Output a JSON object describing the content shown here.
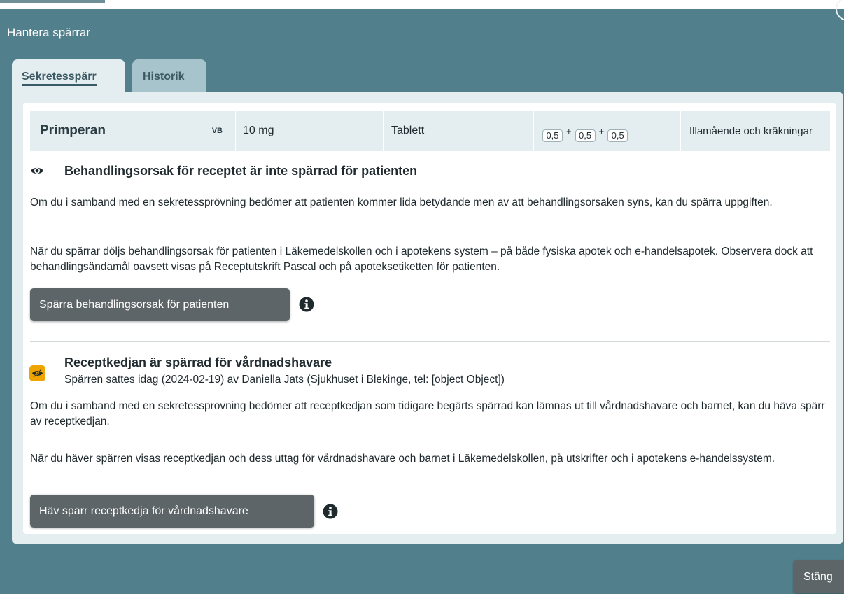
{
  "dialog": {
    "title": "Hantera spärrar"
  },
  "tabs": [
    {
      "label": "Sekretesspärr",
      "active": true
    },
    {
      "label": "Historik",
      "active": false
    }
  ],
  "drug": {
    "name": "Primperan",
    "badge": "VB",
    "strength": "10 mg",
    "form": "Tablett",
    "dosage": [
      "0,5",
      "0,5",
      "0,5"
    ],
    "dosage_separator": "+",
    "indication": "Illamående och kräkningar"
  },
  "treatment_reason": {
    "icon": "eye-icon",
    "heading": "Behandlingsorsak för receptet är inte spärrad för patienten",
    "paragraph1": "Om du i samband med en sekretessprövning bedömer att patienten kommer lida betydande men av att behandlingsorsaken syns, kan du spärra uppgiften.",
    "paragraph2": "När du spärrar döljs behandlingsorsak för patienten i Läkemedelskollen och i apotekens system – på både fysiska apotek och e-handelsapotek. Observera dock att behandlingsändamål oavsett visas på Receptutskrift Pascal och på apoteksetiketten för patienten.",
    "button": "Spärra behandlingsorsak för patienten"
  },
  "prescription_chain": {
    "icon": "eye-slash-icon",
    "badge_color": "#f0a400",
    "heading": "Receptkedjan är spärrad för vårdnadshavare",
    "subline": "Spärren sattes idag (2024-02-19) av Daniella Jats (Sjukhuset i Blekinge, tel: [object Object])",
    "paragraph1": "Om du i samband med en sekretessprövning bedömer att receptkedjan som tidigare begärts spärrad kan lämnas ut till vårdnadshavare och barnet, kan du häva spärr av receptkedjan.",
    "paragraph2": "När du häver spärren visas receptkedjan och dess uttag för vårdnadshavare och barnet i Läkemedelskollen, på utskrifter och i apotekens e-handelssystem.",
    "button": "Häv spärr receptkedja för vårdnadshavare"
  },
  "footer": {
    "close_label": "Stäng"
  }
}
